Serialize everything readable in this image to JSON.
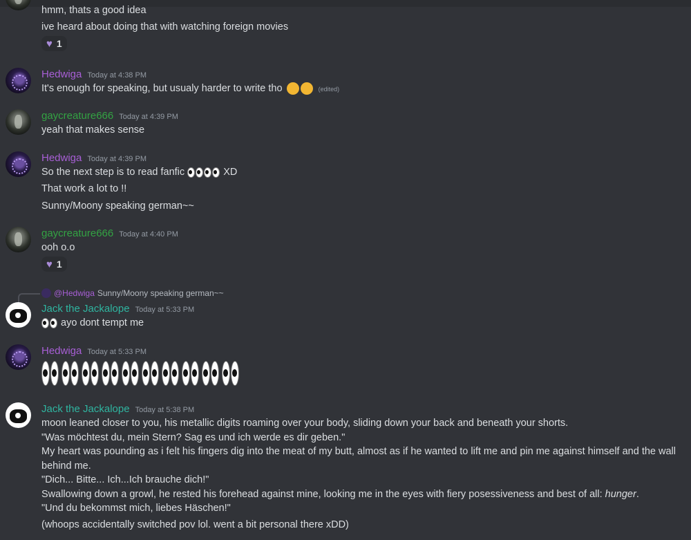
{
  "messages": [
    {
      "id": "m0",
      "lines": [
        "hmm, thats a good idea",
        "ive heard about doing that with watching foreign movies"
      ],
      "reaction": {
        "icon": "purple-heart-icon",
        "count": "1"
      }
    },
    {
      "id": "m1",
      "author": "Hedwiga",
      "time": "Today at 4:38 PM",
      "text": "It's enough for speaking, but usualy harder to write tho",
      "edited": "(edited)"
    },
    {
      "id": "m2",
      "author": "gaycreature666",
      "time": "Today at 4:39 PM",
      "text": "yeah that makes sense"
    },
    {
      "id": "m3",
      "author": "Hedwiga",
      "time": "Today at 4:39 PM",
      "lines": [
        "So the next step is to read fanfic",
        "XD",
        "That work a lot to !!",
        "Sunny/Moony speaking german~~"
      ]
    },
    {
      "id": "m4",
      "author": "gaycreature666",
      "time": "Today at 4:40 PM",
      "text": "ooh o.o",
      "reaction": {
        "icon": "purple-heart-icon",
        "count": "1"
      }
    },
    {
      "id": "m5",
      "author": "Jack the Jackalope",
      "time": "Today at 5:33 PM",
      "reply_mention": "@Hedwiga",
      "reply_text": "Sunny/Moony speaking german~~",
      "text": "ayo dont tempt me"
    },
    {
      "id": "m6",
      "author": "Hedwiga",
      "time": "Today at 5:33 PM"
    },
    {
      "id": "m7",
      "author": "Jack the Jackalope",
      "time": "Today at 5:38 PM",
      "lines": [
        "moon leaned closer to you, his metallic digits roaming over your body, sliding down your back and beneath your shorts.",
        "\"Was möchtest du, mein Stern? Sag es und ich werde es dir geben.\"",
        "My heart was pounding as i felt his fingers dig into the meat of my butt, almost as if he wanted to lift me and pin me against himself and the wall",
        "behind me.",
        "\"Dich... Bitte... Ich...Ich brauche dich!\"",
        "Swallowing down a growl, he rested his forehead against mine, looking me in the eyes with fiery posessiveness and best of all:",
        "hunger",
        ".",
        "\"Und du bekommst mich, liebes Häschen!\"",
        "(whoops accidentally switched pov lol. went a bit personal there xDD)"
      ]
    }
  ]
}
